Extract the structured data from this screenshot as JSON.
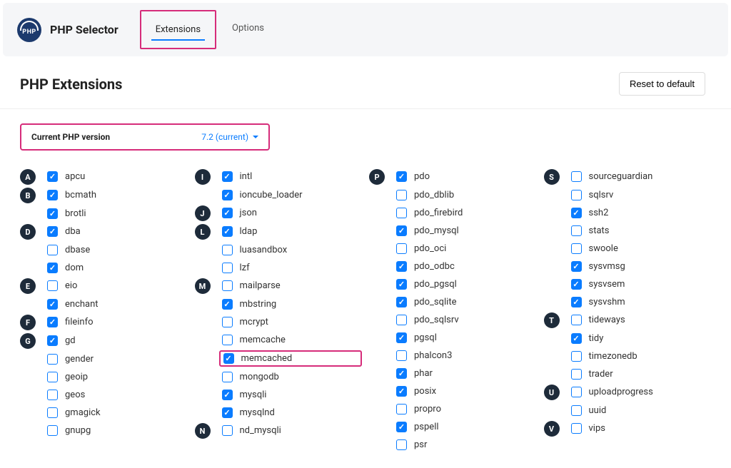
{
  "header": {
    "logo_text": "PHP",
    "title": "PHP Selector",
    "tabs": [
      {
        "label": "Extensions",
        "active": true,
        "highlighted": true
      },
      {
        "label": "Options",
        "active": false,
        "highlighted": false
      }
    ]
  },
  "page": {
    "title": "PHP Extensions",
    "reset_label": "Reset to default"
  },
  "version": {
    "label": "Current PHP version",
    "value": "7.2 (current)"
  },
  "columns": [
    [
      {
        "letter": "A",
        "items": [
          {
            "name": "apcu",
            "checked": true
          }
        ]
      },
      {
        "letter": "B",
        "items": [
          {
            "name": "bcmath",
            "checked": true
          },
          {
            "name": "brotli",
            "checked": true
          }
        ]
      },
      {
        "letter": "D",
        "items": [
          {
            "name": "dba",
            "checked": true
          },
          {
            "name": "dbase",
            "checked": false
          },
          {
            "name": "dom",
            "checked": true
          }
        ]
      },
      {
        "letter": "E",
        "items": [
          {
            "name": "eio",
            "checked": false
          },
          {
            "name": "enchant",
            "checked": true
          }
        ]
      },
      {
        "letter": "F",
        "items": [
          {
            "name": "fileinfo",
            "checked": true
          }
        ]
      },
      {
        "letter": "G",
        "items": [
          {
            "name": "gd",
            "checked": true
          },
          {
            "name": "gender",
            "checked": false
          },
          {
            "name": "geoip",
            "checked": false
          },
          {
            "name": "geos",
            "checked": false
          },
          {
            "name": "gmagick",
            "checked": false
          },
          {
            "name": "gnupg",
            "checked": false
          }
        ]
      }
    ],
    [
      {
        "letter": "I",
        "items": [
          {
            "name": "intl",
            "checked": true
          },
          {
            "name": "ioncube_loader",
            "checked": true
          }
        ]
      },
      {
        "letter": "J",
        "items": [
          {
            "name": "json",
            "checked": true
          }
        ]
      },
      {
        "letter": "L",
        "items": [
          {
            "name": "ldap",
            "checked": true
          },
          {
            "name": "luasandbox",
            "checked": false
          },
          {
            "name": "lzf",
            "checked": false
          }
        ]
      },
      {
        "letter": "M",
        "items": [
          {
            "name": "mailparse",
            "checked": false
          },
          {
            "name": "mbstring",
            "checked": true
          },
          {
            "name": "mcrypt",
            "checked": false
          },
          {
            "name": "memcache",
            "checked": false
          },
          {
            "name": "memcached",
            "checked": true,
            "highlighted": true
          },
          {
            "name": "mongodb",
            "checked": false
          },
          {
            "name": "mysqli",
            "checked": true
          },
          {
            "name": "mysqlnd",
            "checked": true
          }
        ]
      },
      {
        "letter": "N",
        "items": [
          {
            "name": "nd_mysqli",
            "checked": false
          }
        ]
      }
    ],
    [
      {
        "letter": "P",
        "items": [
          {
            "name": "pdo",
            "checked": true
          },
          {
            "name": "pdo_dblib",
            "checked": false
          },
          {
            "name": "pdo_firebird",
            "checked": false
          },
          {
            "name": "pdo_mysql",
            "checked": true
          },
          {
            "name": "pdo_oci",
            "checked": false
          },
          {
            "name": "pdo_odbc",
            "checked": true
          },
          {
            "name": "pdo_pgsql",
            "checked": true
          },
          {
            "name": "pdo_sqlite",
            "checked": true
          },
          {
            "name": "pdo_sqlsrv",
            "checked": false
          },
          {
            "name": "pgsql",
            "checked": true
          },
          {
            "name": "phalcon3",
            "checked": false
          },
          {
            "name": "phar",
            "checked": true
          },
          {
            "name": "posix",
            "checked": true
          },
          {
            "name": "propro",
            "checked": false
          },
          {
            "name": "pspell",
            "checked": true
          },
          {
            "name": "psr",
            "checked": false
          }
        ]
      }
    ],
    [
      {
        "letter": "S",
        "items": [
          {
            "name": "sourceguardian",
            "checked": false
          },
          {
            "name": "sqlsrv",
            "checked": false
          },
          {
            "name": "ssh2",
            "checked": true
          },
          {
            "name": "stats",
            "checked": false
          },
          {
            "name": "swoole",
            "checked": false
          },
          {
            "name": "sysvmsg",
            "checked": true
          },
          {
            "name": "sysvsem",
            "checked": true
          },
          {
            "name": "sysvshm",
            "checked": true
          }
        ]
      },
      {
        "letter": "T",
        "items": [
          {
            "name": "tideways",
            "checked": false
          },
          {
            "name": "tidy",
            "checked": true
          },
          {
            "name": "timezonedb",
            "checked": false
          },
          {
            "name": "trader",
            "checked": false
          }
        ]
      },
      {
        "letter": "U",
        "items": [
          {
            "name": "uploadprogress",
            "checked": false
          },
          {
            "name": "uuid",
            "checked": false
          }
        ]
      },
      {
        "letter": "V",
        "items": [
          {
            "name": "vips",
            "checked": false
          }
        ]
      }
    ]
  ]
}
